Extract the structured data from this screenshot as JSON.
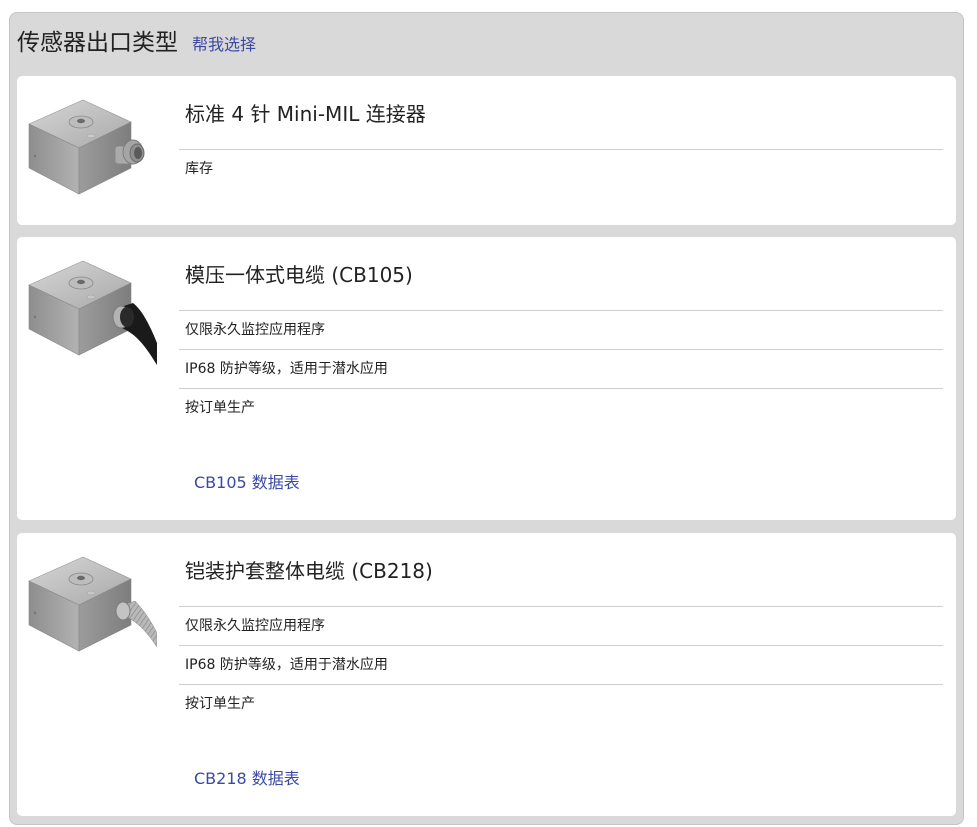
{
  "header": {
    "title": "传感器出口类型",
    "help_link": "帮我选择"
  },
  "options": [
    {
      "title": "标准 4 针 Mini-MIL 连接器",
      "features": [
        "库存"
      ],
      "datasheet": null,
      "image_icon": "sensor-connector-icon"
    },
    {
      "title": "模压一体式电缆 (CB105)",
      "features": [
        "仅限永久监控应用程序",
        "IP68 防护等级，适用于潜水应用",
        "按订单生产"
      ],
      "datasheet": "CB105 数据表",
      "image_icon": "sensor-molded-cable-icon"
    },
    {
      "title": "铠装护套整体电缆 (CB218)",
      "features": [
        "仅限永久监控应用程序",
        "IP68 防护等级，适用于潜水应用",
        "按订单生产"
      ],
      "datasheet": "CB218 数据表",
      "image_icon": "sensor-armored-cable-icon"
    }
  ],
  "colors": {
    "panel_bg": "#d9d9d9",
    "card_bg": "#ffffff",
    "link": "#3c4aa3",
    "divider": "#cfcfcf"
  }
}
